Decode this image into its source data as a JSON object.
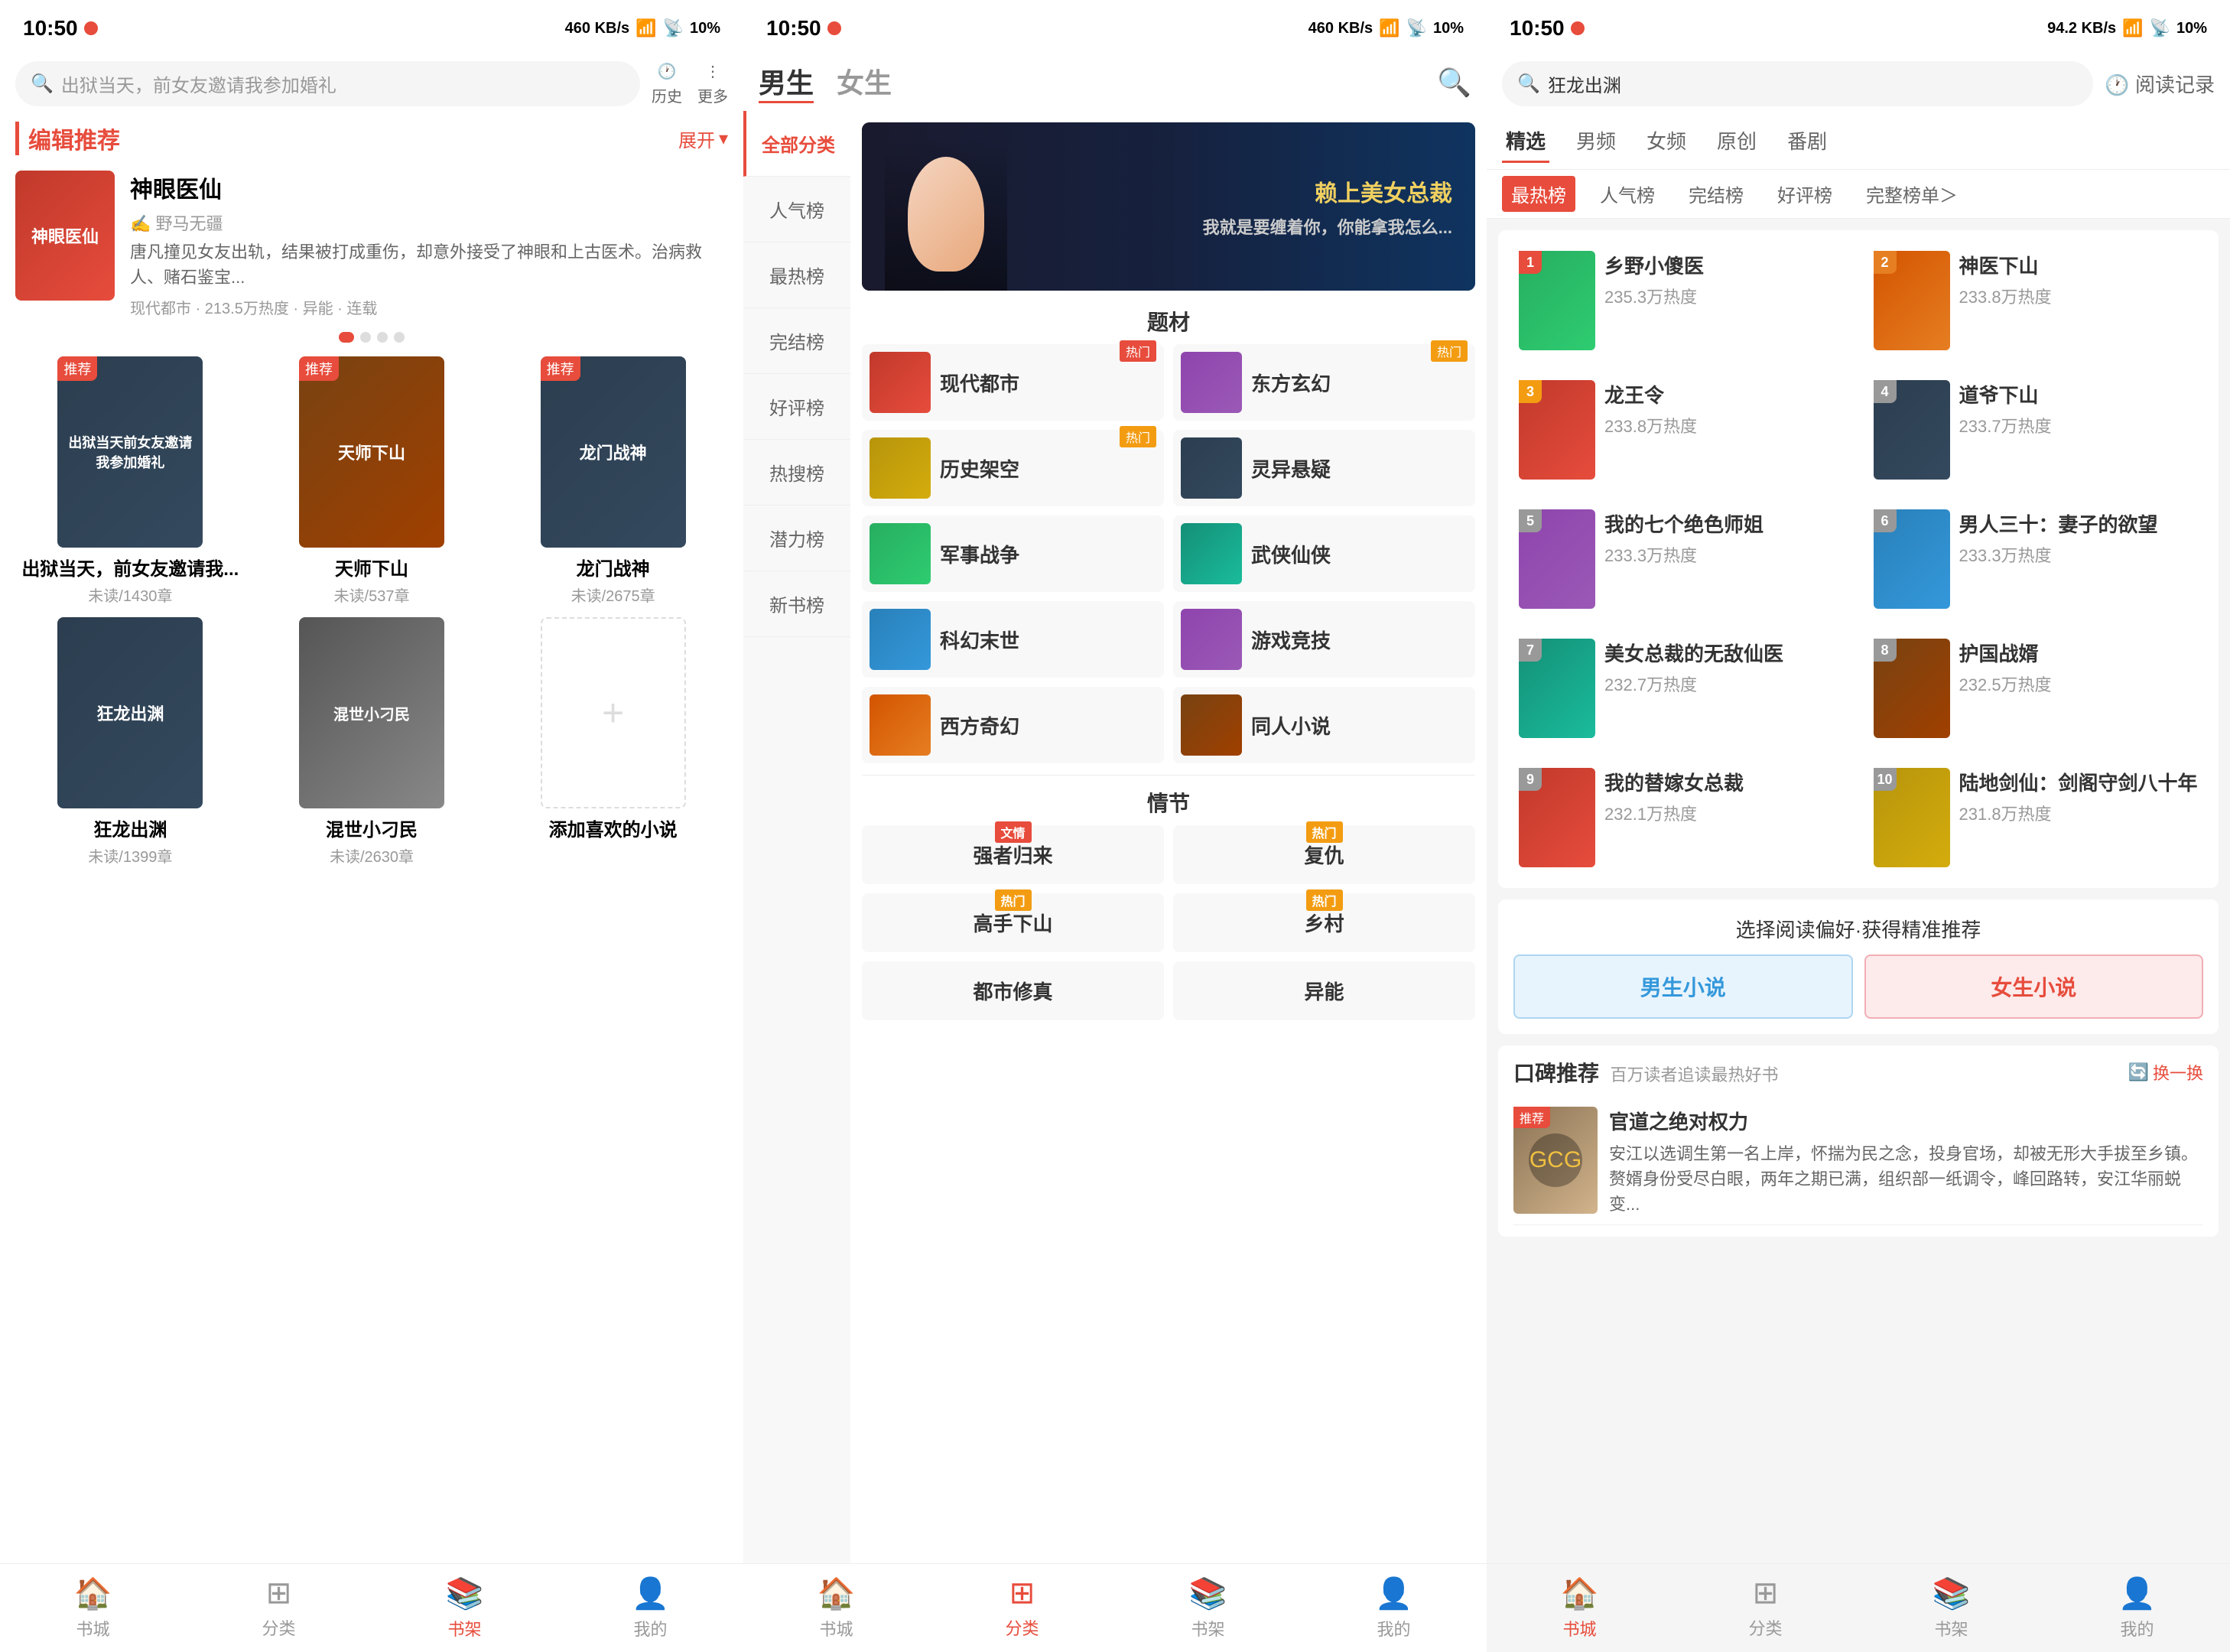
{
  "panels": [
    {
      "id": "panel1",
      "statusBar": {
        "time": "10:50",
        "network": "460 KB/s",
        "signal": "⬆",
        "battery": "10%"
      },
      "search": {
        "placeholder": "出狱当天，前女友邀请我参加婚礼"
      },
      "actions": {
        "history": "历史",
        "more": "更多"
      },
      "editorSection": {
        "title": "编辑推荐",
        "expandLabel": "展开"
      },
      "featuredBook": {
        "title": "神眼医仙",
        "author": "野马无疆",
        "desc": "唐凡撞见女友出轨，结果被打成重伤，却意外接受了神眼和上古医术。治病救人、赌石鉴宝...",
        "meta": "现代都市 · 213.5万热度 · 异能 · 连载"
      },
      "recommendedBooks": [
        {
          "title": "出狱当天，前女友邀请我...",
          "chapters": "未读/1430章",
          "badge": "推荐",
          "color": "cover-dark"
        },
        {
          "title": "天师下山",
          "chapters": "未读/537章",
          "badge": "推荐",
          "color": "cover-brown"
        },
        {
          "title": "龙门战神",
          "chapters": "未读/2675章",
          "badge": "推荐",
          "color": "cover-dark"
        },
        {
          "title": "狂龙出渊",
          "chapters": "未读/1399章",
          "badge": "",
          "color": "cover-dark"
        },
        {
          "title": "混世小刁民",
          "chapters": "未读/2630章",
          "badge": "",
          "color": "cover-gray"
        },
        {
          "title": "添加喜欢的小说",
          "chapters": "",
          "badge": "",
          "color": "",
          "isAdd": true
        }
      ],
      "bottomNav": [
        {
          "label": "书城",
          "icon": "🏠",
          "active": false
        },
        {
          "label": "分类",
          "icon": "⊞",
          "active": false
        },
        {
          "label": "书架",
          "icon": "📚",
          "active": true
        },
        {
          "label": "我的",
          "icon": "👤",
          "active": false
        }
      ]
    },
    {
      "id": "panel2",
      "statusBar": {
        "time": "10:50",
        "network": "460 KB/s",
        "battery": "10%"
      },
      "header": {
        "tabs": [
          {
            "label": "男生",
            "active": true
          },
          {
            "label": "女生",
            "active": false
          }
        ]
      },
      "sidebar": [
        {
          "label": "全部分类",
          "active": true
        },
        {
          "label": "人气榜",
          "active": false
        },
        {
          "label": "最热榜",
          "active": false
        },
        {
          "label": "完结榜",
          "active": false
        },
        {
          "label": "好评榜",
          "active": false
        },
        {
          "label": "热搜榜",
          "active": false
        },
        {
          "label": "潜力榜",
          "active": false
        },
        {
          "label": "新书榜",
          "active": false
        }
      ],
      "banner": {
        "mainText": "赖上美女总裁",
        "subText": "我就是要缠着你，你能拿我怎么..."
      },
      "categories": {
        "title": "题材",
        "items": [
          {
            "label": "现代都市",
            "hot": true,
            "hotColor": "red",
            "color": "cover-red"
          },
          {
            "label": "东方玄幻",
            "hot": true,
            "hotColor": "orange",
            "color": "cover-purple"
          },
          {
            "label": "历史架空",
            "hot": true,
            "hotColor": "orange",
            "color": "cover-gold"
          },
          {
            "label": "灵异悬疑",
            "hot": false,
            "color": "cover-dark"
          },
          {
            "label": "军事战争",
            "hot": false,
            "color": "cover-green"
          },
          {
            "label": "武侠仙侠",
            "hot": false,
            "color": "cover-teal"
          },
          {
            "label": "科幻末世",
            "hot": false,
            "color": "cover-blue"
          },
          {
            "label": "游戏竞技",
            "hot": false,
            "color": "cover-purple"
          },
          {
            "label": "西方奇幻",
            "hot": false,
            "color": "cover-orange"
          },
          {
            "label": "同人小说",
            "hot": false,
            "color": "cover-brown"
          }
        ]
      },
      "emotions": {
        "title": "情节",
        "items": [
          {
            "label": "强者归来",
            "badge": "文情",
            "badgeColor": "red"
          },
          {
            "label": "复仇",
            "badge": "热门",
            "badgeColor": "orange"
          },
          {
            "label": "高手下山",
            "badge": "热门",
            "badgeColor": "orange"
          },
          {
            "label": "乡村",
            "badge": "热门",
            "badgeColor": "orange"
          },
          {
            "label": "都市修真",
            "badge": "",
            "badgeColor": ""
          },
          {
            "label": "异能",
            "badge": "",
            "badgeColor": ""
          }
        ]
      },
      "bottomNav": [
        {
          "label": "书城",
          "icon": "🏠",
          "active": false
        },
        {
          "label": "分类",
          "icon": "⊞",
          "active": true
        },
        {
          "label": "书架",
          "icon": "📚",
          "active": false
        },
        {
          "label": "我的",
          "icon": "👤",
          "active": false
        }
      ]
    },
    {
      "id": "panel3",
      "statusBar": {
        "time": "10:50",
        "network": "94.2 KB/s",
        "battery": "10%"
      },
      "search": {
        "placeholder": "狂龙出渊"
      },
      "readingRecord": "阅读记录",
      "nav": [
        {
          "label": "精选",
          "active": true
        },
        {
          "label": "男频",
          "active": false
        },
        {
          "label": "女频",
          "active": false
        },
        {
          "label": "原创",
          "active": false
        },
        {
          "label": "番剧",
          "active": false
        }
      ],
      "subtabs": [
        {
          "label": "最热榜",
          "active": true
        },
        {
          "label": "人气榜",
          "active": false
        },
        {
          "label": "完结榜",
          "active": false
        },
        {
          "label": "好评榜",
          "active": false
        },
        {
          "label": "完整榜单＞",
          "active": false
        }
      ],
      "rankList": [
        {
          "rank": 1,
          "title": "乡野小傻医",
          "heat": "235.3万热度",
          "color": "cover-green"
        },
        {
          "rank": 2,
          "title": "神医下山",
          "heat": "233.8万热度",
          "color": "cover-orange"
        },
        {
          "rank": 3,
          "title": "龙王令",
          "heat": "233.8万热度",
          "color": "cover-red"
        },
        {
          "rank": 4,
          "title": "道爷下山",
          "heat": "233.7万热度",
          "color": "cover-dark"
        },
        {
          "rank": 5,
          "title": "我的七个绝色师姐",
          "heat": "233.3万热度",
          "color": "cover-purple"
        },
        {
          "rank": 6,
          "title": "男人三十：妻子的欲望",
          "heat": "233.3万热度",
          "color": "cover-blue"
        },
        {
          "rank": 7,
          "title": "美女总裁的无敌仙医",
          "heat": "232.7万热度",
          "color": "cover-teal"
        },
        {
          "rank": 8,
          "title": "护国战婿",
          "heat": "232.5万热度",
          "color": "cover-brown"
        },
        {
          "rank": 9,
          "title": "我的替嫁女总裁",
          "heat": "232.1万热度",
          "color": "cover-red"
        },
        {
          "rank": 10,
          "title": "陆地剑仙：剑阁守剑八十年",
          "heat": "231.8万热度",
          "color": "cover-gold"
        }
      ],
      "preference": {
        "title": "选择阅读偏好·获得精准推荐",
        "male": "男生小说",
        "female": "女生小说"
      },
      "koubei": {
        "title": "口碑推荐",
        "subtitle": "百万读者追读最热好书",
        "refresh": "换一换",
        "book": {
          "title": "官道之绝对权力",
          "badge": "推荐",
          "desc": "安江以选调生第一名上岸，怀揣为民之念，投身官场，却被无形大手拔至乡镇。赘婿身份受尽白眼，两年之期已满，组织部一纸调令，峰回路转，安江华丽蜕变..."
        }
      },
      "bottomNav": [
        {
          "label": "书城",
          "icon": "🏠",
          "active": true
        },
        {
          "label": "分类",
          "icon": "⊞",
          "active": false
        },
        {
          "label": "书架",
          "icon": "📚",
          "active": false
        },
        {
          "label": "我的",
          "icon": "👤",
          "active": false
        }
      ]
    }
  ]
}
